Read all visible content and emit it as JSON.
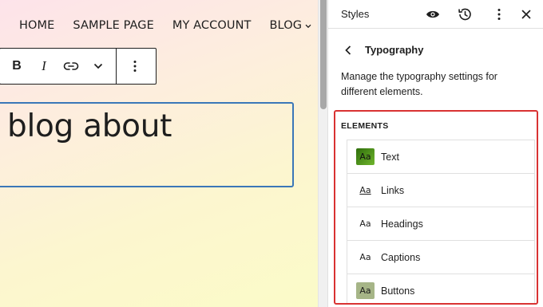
{
  "nav": {
    "items": [
      "HOME",
      "SAMPLE PAGE",
      "MY ACCOUNT",
      "BLOG"
    ]
  },
  "toolbar": {
    "bold_label": "B",
    "italic_label": "I"
  },
  "content": {
    "heading_text": "blog about"
  },
  "sidebar": {
    "title": "Styles",
    "panel_title": "Typography",
    "description": "Manage the typography settings for different elements.",
    "elements_label": "ELEMENTS",
    "elements": [
      {
        "label": "Text",
        "preview": "Aa"
      },
      {
        "label": "Links",
        "preview": "Aa"
      },
      {
        "label": "Headings",
        "preview": "Aa"
      },
      {
        "label": "Captions",
        "preview": "Aa"
      },
      {
        "label": "Buttons",
        "preview": "Aa"
      }
    ]
  },
  "colors": {
    "highlight_border": "#d93232",
    "block_border": "#3a77b8",
    "text_swatch": "#4a8f1c",
    "buttons_swatch": "#a6b587"
  },
  "icons": {
    "header": [
      "eye-icon",
      "history-icon",
      "more-vertical-icon",
      "close-icon"
    ],
    "toolbar": [
      "link-icon",
      "chevron-down-icon",
      "more-vertical-icon"
    ],
    "panel": [
      "chevron-left-icon"
    ]
  }
}
